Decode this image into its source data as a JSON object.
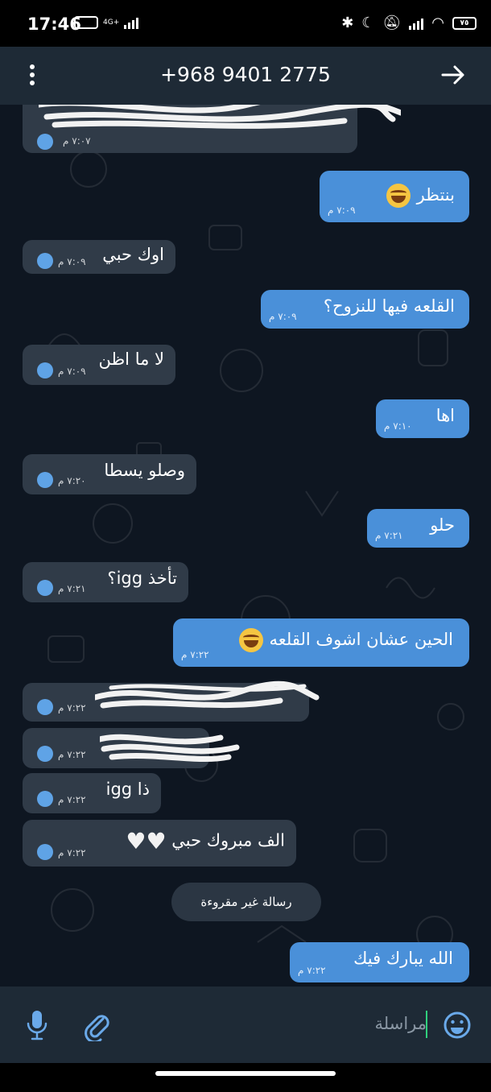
{
  "status_bar": {
    "time": "17:46",
    "left_small": "4G+",
    "battery": "٧٥",
    "icons": [
      "bluetooth-icon",
      "moon-icon",
      "mute-icon",
      "signal-icon",
      "wifi-icon",
      "battery-icon"
    ]
  },
  "header": {
    "title": "+968 9401 2775",
    "menu_icon": "more-vertical-icon",
    "back_icon": "arrow-right-icon"
  },
  "messages": [
    {
      "side": "in",
      "text": "",
      "time": "٧:٠٧ م",
      "redacted": true
    },
    {
      "side": "out",
      "text": "بنتظر",
      "time": "٧:٠٩ م",
      "emoji": "laugh"
    },
    {
      "side": "in",
      "text": "اوك حبي",
      "time": "٧:٠٩ م"
    },
    {
      "side": "out",
      "text": "القلعه فيها للنزوح؟",
      "time": "٧:٠٩ م"
    },
    {
      "side": "in",
      "text": "لا ما اظن",
      "time": "٧:٠٩ م"
    },
    {
      "side": "out",
      "text": "اها",
      "time": "٧:١٠ م"
    },
    {
      "side": "in",
      "text": "وصلو يسطا",
      "time": "٧:٢٠ م"
    },
    {
      "side": "out",
      "text": "حلو",
      "time": "٧:٢١ م"
    },
    {
      "side": "in",
      "text": "تأخذ igg؟",
      "time": "٧:٢١ م"
    },
    {
      "side": "out",
      "text": "الحين عشان اشوف القلعه",
      "time": "٧:٢٢ م",
      "emoji": "laugh"
    },
    {
      "side": "in",
      "text": "",
      "time": "٧:٢٢ م",
      "redacted": true
    },
    {
      "side": "in",
      "text": "",
      "time": "٧:٢٢ م",
      "redacted": true
    },
    {
      "side": "in",
      "text": "ذا igg",
      "time": "٧:٢٢ م"
    },
    {
      "side": "in",
      "text": "الف مبروك حبي",
      "time": "٧:٢٢ م",
      "hearts": 2
    },
    {
      "side": "out",
      "text": "الله يبارك فيك",
      "time": "٧:٢٢ م"
    }
  ],
  "unread_divider": "رسالة غير مقروءة",
  "input": {
    "placeholder": "مراسلة",
    "mic_icon": "microphone-icon",
    "attach_icon": "paperclip-icon",
    "emoji_icon": "smile-icon"
  },
  "colors": {
    "header_bg": "#1e2a36",
    "chat_bg": "#0e1621",
    "incoming_bubble": "#303b48",
    "outgoing_bubble": "#4a90d9",
    "read_indicator": "#5fa3e6"
  }
}
